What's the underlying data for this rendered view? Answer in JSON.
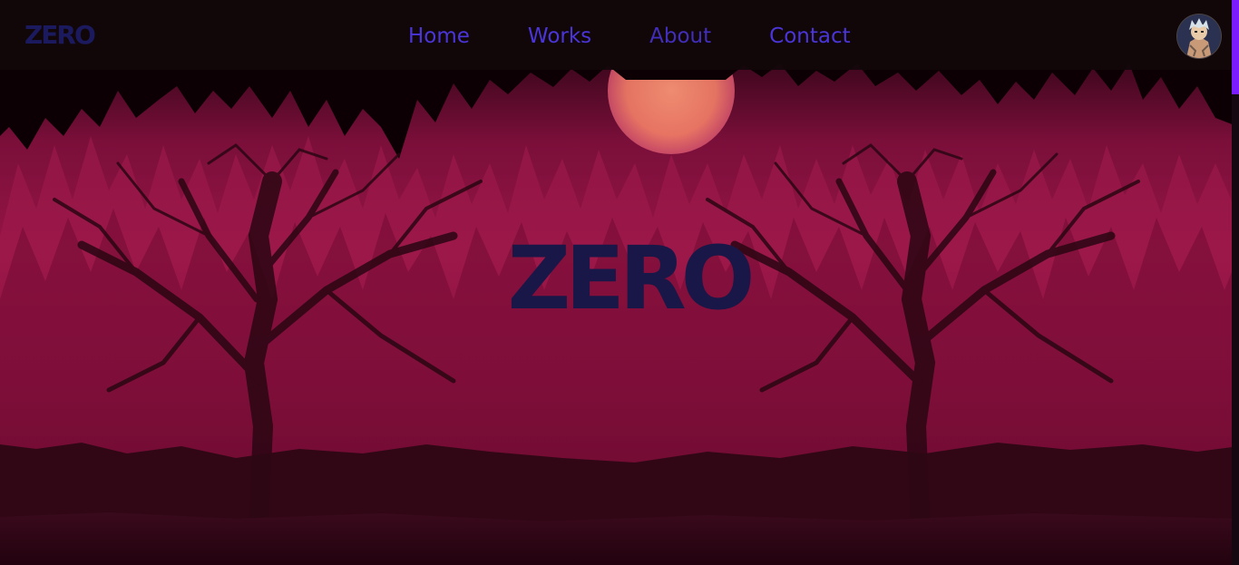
{
  "navbar": {
    "brand": "ZERO",
    "links": [
      "Home",
      "Works",
      "About",
      "Contact"
    ]
  },
  "hero": {
    "title": "ZERO"
  },
  "icons": {
    "avatar": "profile-avatar-icon"
  },
  "colors": {
    "nav_link": "#4a35d9",
    "brand": "#1c1a5e",
    "hero_title": "#191747",
    "navbar_bg": "#12080a",
    "scrollbar_thumb": "#7a1cff",
    "sky_top": "#1a0008",
    "forest": "#8c1040",
    "moon": "#f47f68"
  }
}
